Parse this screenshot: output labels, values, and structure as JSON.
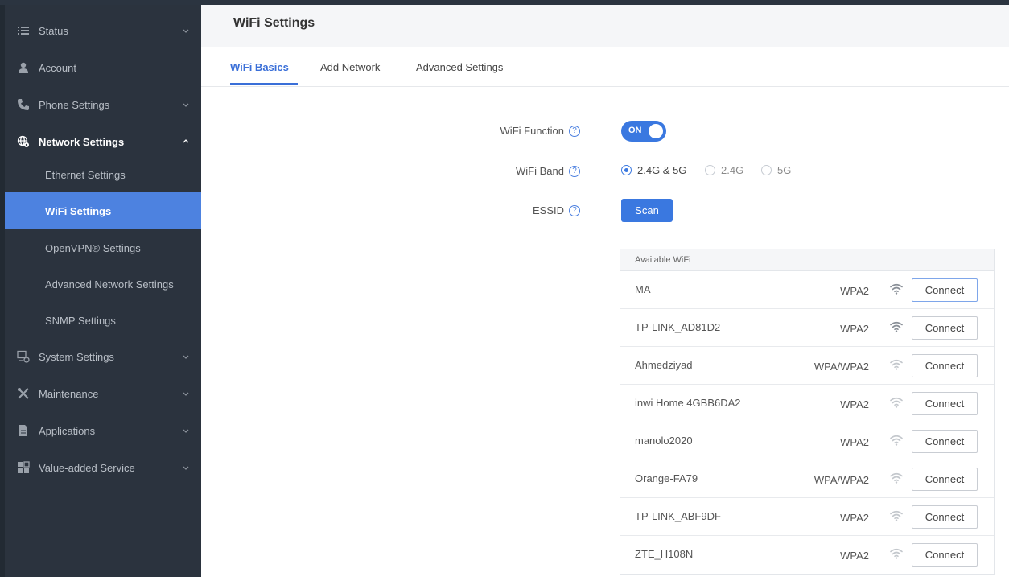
{
  "sidebar": {
    "items": [
      {
        "label": "Status",
        "icon": "list-icon",
        "chevron": "down"
      },
      {
        "label": "Account",
        "icon": "user-icon",
        "chevron": ""
      },
      {
        "label": "Phone Settings",
        "icon": "phone-icon",
        "chevron": "down"
      },
      {
        "label": "Network Settings",
        "icon": "network-icon",
        "chevron": "up"
      },
      {
        "label": "Ethernet Settings"
      },
      {
        "label": "WiFi Settings"
      },
      {
        "label": "OpenVPN® Settings"
      },
      {
        "label": "Advanced Network Settings"
      },
      {
        "label": "SNMP Settings"
      },
      {
        "label": "System Settings",
        "icon": "system-icon",
        "chevron": "down"
      },
      {
        "label": "Maintenance",
        "icon": "tools-icon",
        "chevron": "down"
      },
      {
        "label": "Applications",
        "icon": "document-icon",
        "chevron": "down"
      },
      {
        "label": "Value-added Service",
        "icon": "apps-icon",
        "chevron": "down"
      }
    ]
  },
  "header": {
    "title": "WiFi Settings"
  },
  "tabs": [
    {
      "label": "WiFi Basics",
      "active": true
    },
    {
      "label": "Add Network",
      "active": false
    },
    {
      "label": "Advanced Settings",
      "active": false
    }
  ],
  "form": {
    "wifi_function_label": "WiFi Function",
    "wifi_function_state": "ON",
    "wifi_band_label": "WiFi Band",
    "band_options": [
      {
        "label": "2.4G & 5G",
        "selected": true
      },
      {
        "label": "2.4G",
        "selected": false
      },
      {
        "label": "5G",
        "selected": false
      }
    ],
    "essid_label": "ESSID",
    "scan_label": "Scan",
    "help_glyph": "?"
  },
  "wifi_list": {
    "header": "Available WiFi",
    "connect_label": "Connect",
    "networks": [
      {
        "ssid": "MA",
        "security": "WPA2",
        "signal": "strong"
      },
      {
        "ssid": "TP-LINK_AD81D2",
        "security": "WPA2",
        "signal": "strong"
      },
      {
        "ssid": "Ahmedziyad",
        "security": "WPA/WPA2",
        "signal": "weak"
      },
      {
        "ssid": "inwi Home 4GBB6DA2",
        "security": "WPA2",
        "signal": "weak"
      },
      {
        "ssid": "manolo2020",
        "security": "WPA2",
        "signal": "weak"
      },
      {
        "ssid": "Orange-FA79",
        "security": "WPA/WPA2",
        "signal": "weak"
      },
      {
        "ssid": "TP-LINK_ABF9DF",
        "security": "WPA2",
        "signal": "weak"
      },
      {
        "ssid": "ZTE_H108N",
        "security": "WPA2",
        "signal": "weak"
      }
    ]
  },
  "colors": {
    "accent": "#3a78e0",
    "sidebar_bg": "#2b333e",
    "active_item": "#4d82e0"
  }
}
